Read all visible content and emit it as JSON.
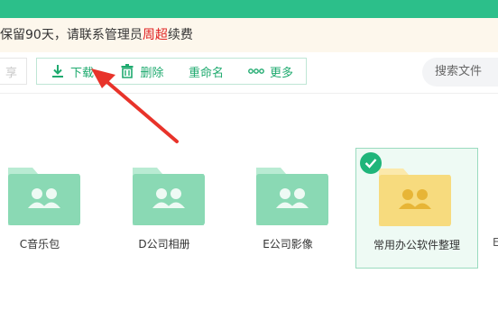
{
  "notice": {
    "before": "保留90天，请联系管理员",
    "highlight": "周超",
    "after": "续费"
  },
  "toolbar": {
    "share_label": "享",
    "download_label": "下载",
    "delete_label": "删除",
    "rename_label": "重命名",
    "more_label": "更多"
  },
  "search": {
    "placeholder": "搜索文件"
  },
  "folders": [
    {
      "name": "C音乐包",
      "color": "#8ad9b4",
      "selected": false
    },
    {
      "name": "D公司相册",
      "color": "#8ad9b4",
      "selected": false
    },
    {
      "name": "E公司影像",
      "color": "#8ad9b4",
      "selected": false
    },
    {
      "name": "常用办公软件整理",
      "color": "#f7db7e",
      "selected": true
    }
  ],
  "edge_folder": {
    "name": "E"
  },
  "colors": {
    "accent": "#1faa6f",
    "topbar": "#2cbf8a",
    "highlight": "#e02020",
    "annotation_arrow": "#e8332a"
  }
}
